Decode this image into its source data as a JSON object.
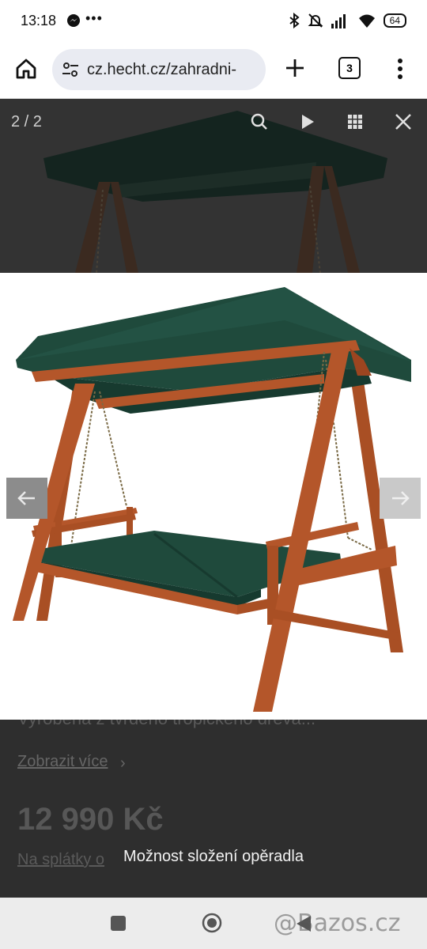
{
  "status_bar": {
    "time": "13:18",
    "battery": "64",
    "icons": [
      "messenger-icon",
      "more-dots-icon",
      "bluetooth-icon",
      "mute-icon",
      "signal-icon",
      "wifi-icon",
      "battery-icon"
    ]
  },
  "browser": {
    "url": "cz.hecht.cz/zahradni-",
    "tab_count": "3",
    "icons": [
      "home-icon",
      "tune-icon",
      "plus-icon",
      "tabs-icon",
      "menu-icon"
    ]
  },
  "viewer": {
    "counter": "2 / 2",
    "icons": [
      "search-icon",
      "play-icon",
      "grid-icon",
      "close-icon"
    ],
    "caption": "Možnost složení opěradla",
    "image_subject": "wooden garden swing bed with green canopy and cushions"
  },
  "page_behind": {
    "description_snippet": "Vyrobená z tvrdého tropického dřeva...",
    "show_more": "Zobrazit více",
    "price": "12 990 Kč",
    "installments": "Na splátky o"
  },
  "watermark": "@Bazos.cz",
  "colors": {
    "canopy": "#1f4a3c",
    "wood": "#b4562a",
    "overlay": "#2d2d2d"
  }
}
